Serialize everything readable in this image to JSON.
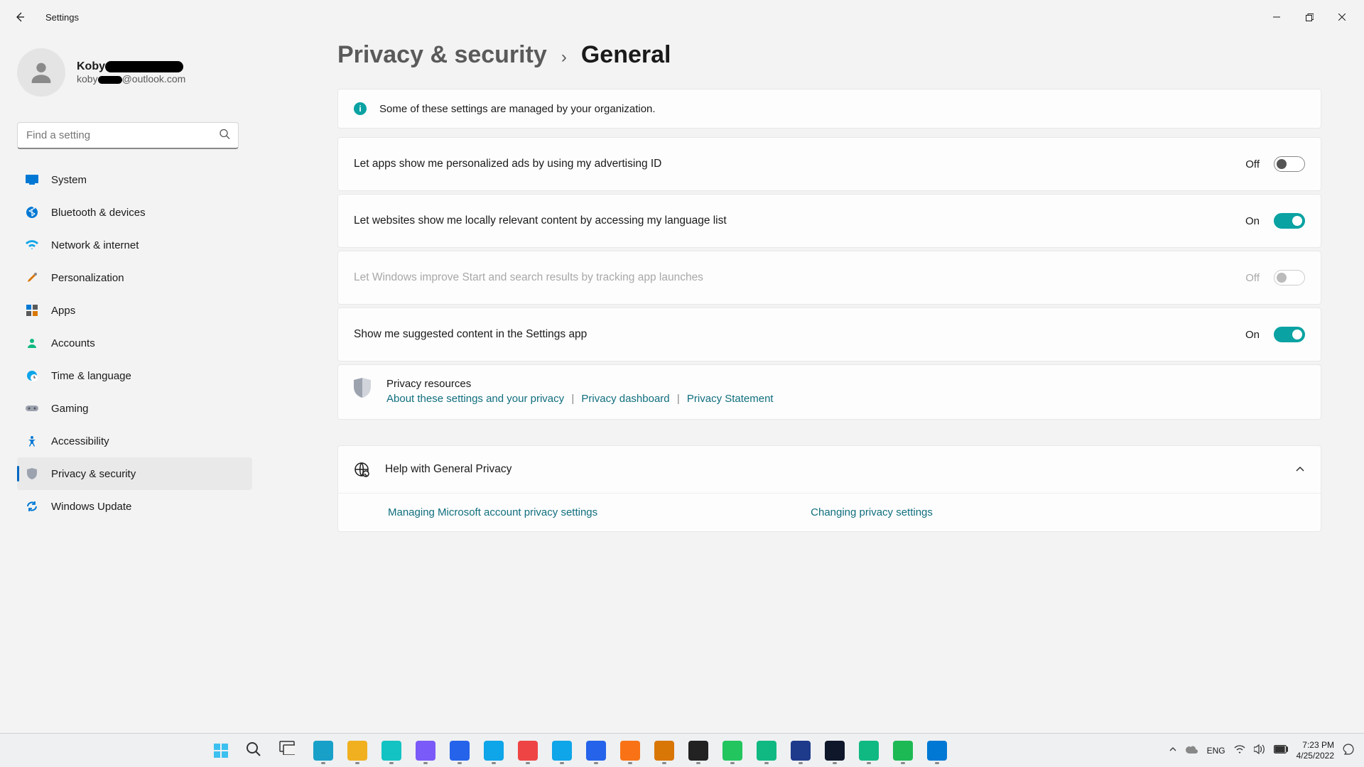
{
  "window": {
    "title": "Settings"
  },
  "account": {
    "name": "Koby",
    "email_prefix": "koby",
    "email_suffix": "@outlook.com"
  },
  "search": {
    "placeholder": "Find a setting"
  },
  "sidebar": {
    "items": [
      {
        "label": "System"
      },
      {
        "label": "Bluetooth & devices"
      },
      {
        "label": "Network & internet"
      },
      {
        "label": "Personalization"
      },
      {
        "label": "Apps"
      },
      {
        "label": "Accounts"
      },
      {
        "label": "Time & language"
      },
      {
        "label": "Gaming"
      },
      {
        "label": "Accessibility"
      },
      {
        "label": "Privacy & security"
      },
      {
        "label": "Windows Update"
      }
    ]
  },
  "breadcrumb": {
    "parent": "Privacy & security",
    "current": "General"
  },
  "info_banner": "Some of these settings are managed by your organization.",
  "settings": [
    {
      "label": "Let apps show me personalized ads by using my advertising ID",
      "state": "Off",
      "on": false,
      "disabled": false
    },
    {
      "label": "Let websites show me locally relevant content by accessing my language list",
      "state": "On",
      "on": true,
      "disabled": false
    },
    {
      "label": "Let Windows improve Start and search results by tracking app launches",
      "state": "Off",
      "on": false,
      "disabled": true
    },
    {
      "label": "Show me suggested content in the Settings app",
      "state": "On",
      "on": true,
      "disabled": false
    }
  ],
  "resources": {
    "title": "Privacy resources",
    "links": [
      "About these settings and your privacy",
      "Privacy dashboard",
      "Privacy Statement"
    ]
  },
  "help": {
    "title": "Help with General Privacy",
    "links": [
      "Managing Microsoft account privacy settings",
      "Changing privacy settings"
    ]
  },
  "tray": {
    "lang": "ENG",
    "time": "7:23 PM",
    "date": "4/25/2022"
  },
  "taskbar_icons": [
    "start",
    "search",
    "task-view",
    "edge",
    "explorer",
    "canva",
    "clipchamp",
    "app4",
    "app5",
    "kinemaster",
    "app7",
    "app8",
    "blender",
    "app10",
    "obs",
    "meet",
    "play-store",
    "ms-store",
    "amazon",
    "app15",
    "spotify",
    "snipping-tool"
  ]
}
